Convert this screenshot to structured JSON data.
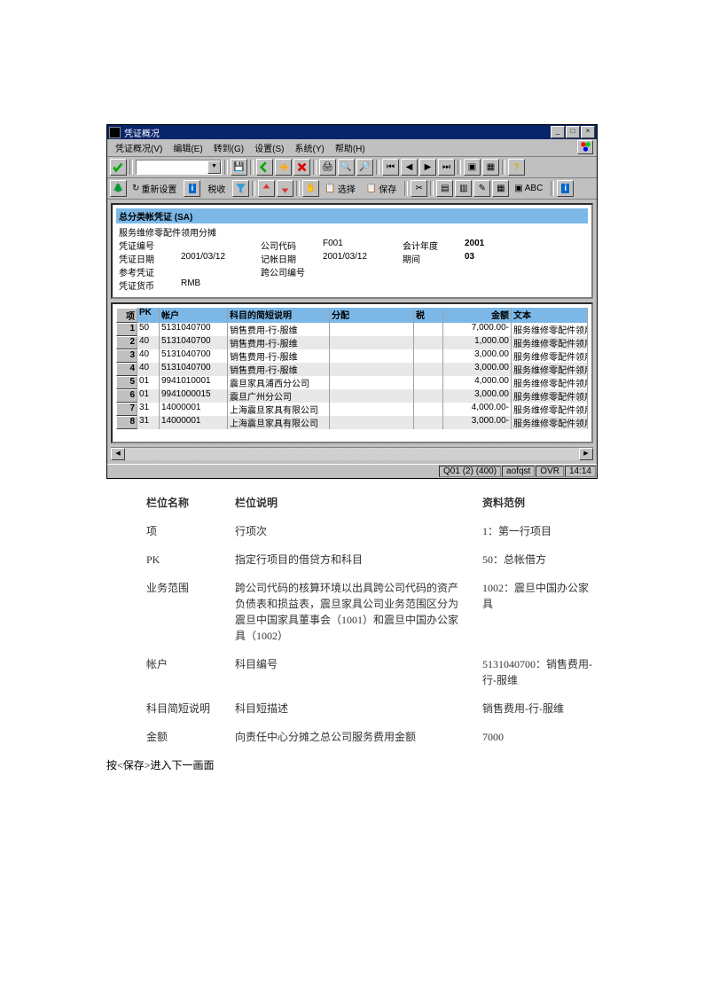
{
  "titlebar": "凭证概况",
  "menu": [
    "凭证概况(V)",
    "编辑(E)",
    "转到(G)",
    "设置(S)",
    "系统(Y)",
    "帮助(H)"
  ],
  "tb2": {
    "reset": "重新设置",
    "tax": "税收",
    "select": "选择",
    "save": "保存",
    "abc": "ABC"
  },
  "header": {
    "type": "总分类帐凭证 (SA)",
    "subtitle": "服务维修零配件领用分摊",
    "rows": [
      {
        "l1": "凭证编号",
        "v1": "",
        "l2": "公司代码",
        "v2": "F001",
        "l3": "会计年度",
        "v3": "2001"
      },
      {
        "l1": "凭证日期",
        "v1": "2001/03/12",
        "l2": "记帐日期",
        "v2": "2001/03/12",
        "l3": "期间",
        "v3": "03"
      },
      {
        "l1": "参考凭证",
        "v1": "",
        "l2": "跨公司编号",
        "v2": "",
        "l3": "",
        "v3": ""
      },
      {
        "l1": "凭证货币",
        "v1": "RMB",
        "l2": "",
        "v2": "",
        "l3": "",
        "v3": ""
      }
    ]
  },
  "cols": {
    "idx": "项",
    "pk": "PK",
    "acct": "帐户",
    "desc": "科目的简短说明",
    "alloc": "分配",
    "tax": "税",
    "amt": "金额",
    "txt": "文本"
  },
  "rows": [
    {
      "idx": "1",
      "pk": "50",
      "acct": "5131040700",
      "desc": "销售费用-行-服维",
      "amt": "7,000.00-",
      "txt": "服务维修零配件领用"
    },
    {
      "idx": "2",
      "pk": "40",
      "acct": "5131040700",
      "desc": "销售费用-行-服维",
      "amt": "1,000.00",
      "txt": "服务维修零配件领用"
    },
    {
      "idx": "3",
      "pk": "40",
      "acct": "5131040700",
      "desc": "销售费用-行-服维",
      "amt": "3,000.00",
      "txt": "服务维修零配件领用"
    },
    {
      "idx": "4",
      "pk": "40",
      "acct": "5131040700",
      "desc": "销售费用-行-服维",
      "amt": "3,000.00",
      "txt": "服务维修零配件领用"
    },
    {
      "idx": "5",
      "pk": "01",
      "acct": "9941010001",
      "desc": "震旦家具浦西分公司",
      "amt": "4,000.00",
      "txt": "服务维修零配件领用"
    },
    {
      "idx": "6",
      "pk": "01",
      "acct": "9941000015",
      "desc": "震旦广州分公司",
      "amt": "3,000.00",
      "txt": "服务维修零配件领用"
    },
    {
      "idx": "7",
      "pk": "31",
      "acct": "14000001",
      "desc": "上海震旦家具有限公司",
      "amt": "4,000.00-",
      "txt": "服务维修零配件领用"
    },
    {
      "idx": "8",
      "pk": "31",
      "acct": "14000001",
      "desc": "上海震旦家具有限公司",
      "amt": "3,000.00-",
      "txt": "服务维修零配件领用"
    }
  ],
  "status": {
    "sess": "Q01 (2) (400)",
    "user": "aofqst",
    "mode": "OVR",
    "time": "14:14"
  },
  "fieldHdr": {
    "name": "栏位名称",
    "desc": "栏位说明",
    "ex": "资料范例"
  },
  "fields": [
    {
      "n": "项",
      "d": "行项次",
      "e": "1：第一行项目"
    },
    {
      "n": "PK",
      "d": "指定行项目的借贷方和科目",
      "e": "50：总帐借方"
    },
    {
      "n": "业务范围",
      "d": "跨公司代码的核算环境以出具跨公司代码的资产负债表和损益表，震旦家具公司业务范围区分为震旦中国家具董事会（1001）和震旦中国办公家具（1002）",
      "e": "1002：震旦中国办公家具"
    },
    {
      "n": "帐户",
      "d": "科目编号",
      "e": "5131040700：销售费用-行-服维"
    },
    {
      "n": "科目简短说明",
      "d": "科目短描述",
      "e": "销售费用-行-服维"
    },
    {
      "n": "金额",
      "d": "向责任中心分摊之总公司服务费用金额",
      "e": "7000"
    }
  ],
  "note": "按<保存>进入下一画面"
}
